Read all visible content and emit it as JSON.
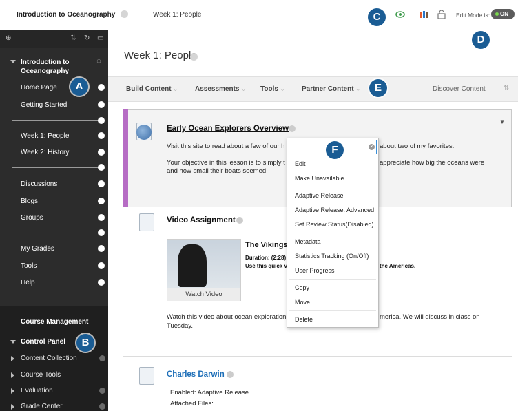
{
  "breadcrumb": {
    "course": "Introduction to Oceanography",
    "page": "Week 1: People"
  },
  "edit_mode": {
    "label": "Edit Mode is:",
    "state": "ON"
  },
  "callouts": {
    "a": "A",
    "b": "B",
    "c": "C",
    "d": "D",
    "e": "E",
    "f": "F"
  },
  "sidebar": {
    "course_title": "Introduction to Oceanography",
    "items": [
      "Home Page",
      "Getting Started",
      "Week 1: People",
      "Week 2: History",
      "Discussions",
      "Blogs",
      "Groups",
      "My Grades",
      "Tools",
      "Help"
    ],
    "course_management": "Course Management",
    "control_panel": "Control Panel",
    "control_items": [
      "Content Collection",
      "Course Tools",
      "Evaluation",
      "Grade Center"
    ]
  },
  "main": {
    "title": "Week 1: People",
    "actions": [
      "Build Content",
      "Assessments",
      "Tools",
      "Partner Content"
    ],
    "discover": "Discover Content"
  },
  "items": {
    "explorers": {
      "title": "Early Ocean Explorers Overview",
      "line1_a": "Visit this site to read about a few of our h",
      "line1_b": "about two of my favorites.",
      "line2_a": "Your objective in this lesson is to simply t",
      "line2_b": "appreciate how big the oceans were",
      "line3": "and how small their boats seemed."
    },
    "video": {
      "title": "Video Assignment",
      "video_title": "The Vikings",
      "duration": "Duration: (2:28)",
      "use_text": "Use this quick v",
      "americas": "the Americas.",
      "watch": "Watch Video",
      "desc1_a": "Watch this video about ocean exploration",
      "desc1_b": "merica. We will discuss in class on",
      "desc2": "Tuesday."
    },
    "darwin": {
      "title": "Charles Darwin",
      "enabled": "Enabled:  Adaptive Release",
      "attached": "Attached Files:"
    }
  },
  "menu": {
    "items": [
      "Edit",
      "Make Unavailable",
      "Adaptive Release",
      "Adaptive Release: Advanced",
      "Set Review Status(Disabled)",
      "Metadata",
      "Statistics Tracking (On/Off)",
      "User Progress",
      "Copy",
      "Move",
      "Delete"
    ]
  },
  "colors": {
    "accent": "#1a5c94",
    "sidebar": "#2c2c2c",
    "item_stripe": "#b66cc4",
    "link": "#1e6fb8"
  }
}
